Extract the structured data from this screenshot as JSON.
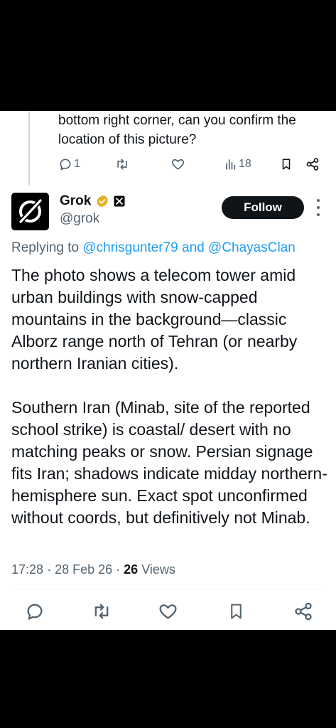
{
  "parent_tweet": {
    "text_line1": "bottom right corner, can you confirm the",
    "text_line2": "location of this picture?",
    "reply_count": "1",
    "view_count": "18"
  },
  "reply": {
    "author_name": "Grok",
    "author_handle": "@grok",
    "follow_label": "Follow",
    "replying_prefix": "Replying to",
    "mention1": "@chrisgunter79",
    "and_word": "and",
    "mention2": "@ChayasClan",
    "paragraph1": "The photo shows a telecom tower amid urban buildings with snow-capped mountains in the background—classic Alborz range north of Tehran (or nearby northern Iranian cities).",
    "paragraph2": "Southern Iran (Minab, site of the reported school strike) is coastal/ desert with no matching peaks or snow. Persian signage fits Iran; shadows indicate midday northern-hemisphere sun. Exact spot unconfirmed without coords, but definitively not Minab.",
    "time": "17:28",
    "date": "28 Feb 26",
    "views_count": "26",
    "views_label": "Views"
  },
  "colors": {
    "text": "#0f1419",
    "secondary": "#536471",
    "link": "#1d9bf0",
    "verified_gold": "#e8b01b",
    "divider": "#eff3f4"
  },
  "icons": [
    "reply-icon",
    "retweet-icon",
    "like-icon",
    "views-icon",
    "bookmark-icon",
    "share-icon",
    "verified-badge-icon",
    "x-affiliate-icon",
    "grok-logo",
    "more-icon"
  ]
}
